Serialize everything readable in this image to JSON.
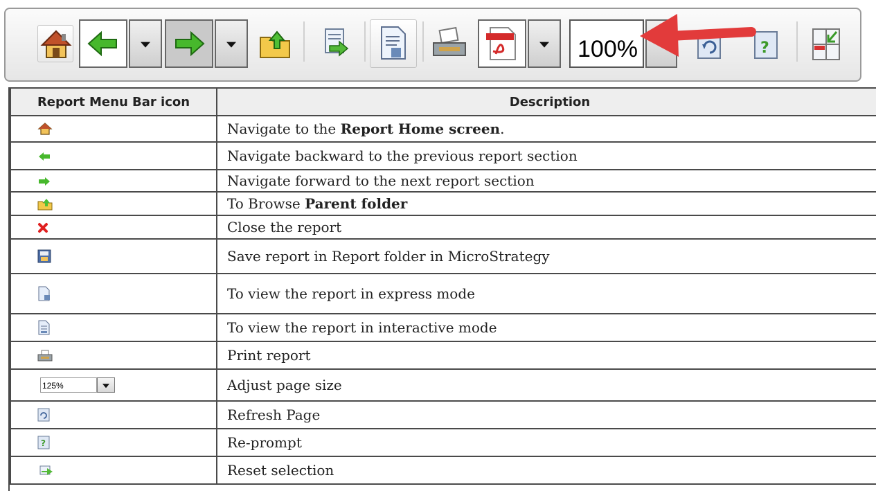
{
  "toolbar": {
    "zoom_value": "100%",
    "icons": [
      "home-icon",
      "back-arrow-icon",
      "forward-arrow-icon",
      "parent-folder-icon",
      "reset-selection-icon",
      "express-mode-icon",
      "print-icon",
      "pdf-export-icon",
      "refresh-icon",
      "reprompt-icon",
      "close-report-icon"
    ],
    "annotation_arrow_color": "#e23b3b"
  },
  "table": {
    "headers": {
      "icon": "Report Menu Bar icon",
      "description": "Description"
    },
    "rows": [
      {
        "icon": "home-icon",
        "desc_pre": "Navigate  to the ",
        "desc_bold": "Report Home screen",
        "desc_post": "."
      },
      {
        "icon": "back-arrow-icon",
        "desc_pre": "Navigate  backward to the previous  report section",
        "desc_bold": "",
        "desc_post": ""
      },
      {
        "icon": "forward-arrow-icon",
        "desc_pre": "Navigate  forward to the next report section",
        "desc_bold": "",
        "desc_post": ""
      },
      {
        "icon": "parent-folder-icon",
        "desc_pre": "To  Browse ",
        "desc_bold": "Parent folder",
        "desc_post": ""
      },
      {
        "icon": "close-icon",
        "desc_pre": "Close  the  report",
        "desc_bold": "",
        "desc_post": ""
      },
      {
        "icon": "save-icon",
        "desc_pre": "Save report in  Report folder  in  MicroStrategy",
        "desc_bold": "",
        "desc_post": ""
      },
      {
        "icon": "express-mode-icon",
        "desc_pre": "To  view  the report in  express mode",
        "desc_bold": "",
        "desc_post": ""
      },
      {
        "icon": "interactive-mode-icon",
        "desc_pre": "To  view  the report in  interactive  mode",
        "desc_bold": "",
        "desc_post": ""
      },
      {
        "icon": "print-icon",
        "desc_pre": "Print report",
        "desc_bold": "",
        "desc_post": ""
      },
      {
        "icon": "zoom-select",
        "desc_pre": "Adjust  page size",
        "desc_bold": "",
        "desc_post": ""
      },
      {
        "icon": "refresh-icon",
        "desc_pre": "Refresh  Page",
        "desc_bold": "",
        "desc_post": ""
      },
      {
        "icon": "reprompt-icon",
        "desc_pre": "Re-prompt",
        "desc_bold": "",
        "desc_post": ""
      },
      {
        "icon": "reset-selection-icon",
        "desc_pre": "Reset  selection",
        "desc_bold": "",
        "desc_post": ""
      }
    ],
    "zoom_mini_value": "125%"
  }
}
